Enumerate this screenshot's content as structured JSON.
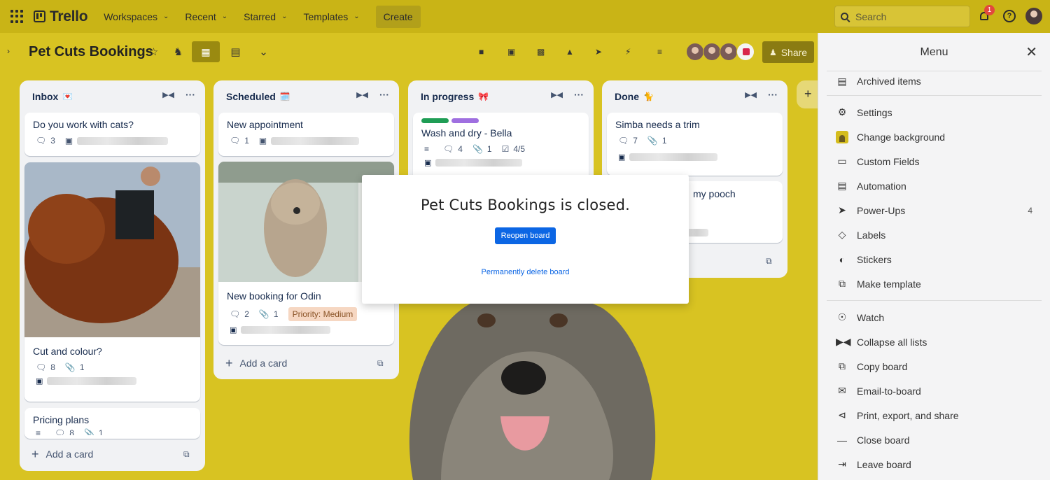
{
  "nav": {
    "logo": "Trello",
    "items": [
      "Workspaces",
      "Recent",
      "Starred",
      "Templates"
    ],
    "create": "Create",
    "search_placeholder": "Search",
    "notification_count": "1"
  },
  "board": {
    "title": "Pet Cuts Bookings",
    "share": "Share"
  },
  "lists": [
    {
      "title": "Inbox",
      "emoji": "💌",
      "cards": [
        {
          "title": "Do you work with cats?",
          "comments": "3"
        },
        {
          "title": "Cut and colour?",
          "comments": "8",
          "attachments": "1"
        },
        {
          "title": "Pricing plans",
          "comments": "8",
          "attachments": "1"
        }
      ],
      "add": "Add a card"
    },
    {
      "title": "Scheduled",
      "emoji": "🗓️",
      "cards": [
        {
          "title": "New appointment",
          "comments": "1"
        },
        {
          "title": "New booking for Odin",
          "comments": "2",
          "attachments": "1",
          "priority": "Priority: Medium"
        }
      ],
      "add": "Add a card"
    },
    {
      "title": "In progress",
      "emoji": "🎀",
      "cards": [
        {
          "title": "Wash and dry - Bella",
          "comments": "4",
          "attachments": "1",
          "checklist": "4/5",
          "labels": [
            "#1f9d55",
            "#9f6fe0"
          ]
        }
      ]
    },
    {
      "title": "Done",
      "emoji": "🐈",
      "cards": [
        {
          "title": "Simba needs a trim",
          "comments": "7",
          "attachments": "1"
        },
        {
          "title": "my pooch"
        }
      ]
    }
  ],
  "modal": {
    "message": "Pet Cuts Bookings is closed.",
    "reopen": "Reopen board",
    "delete": "Permanently delete board"
  },
  "menu": {
    "title": "Menu",
    "items": [
      {
        "label": "Archived items",
        "icon": "archive-icon"
      },
      {
        "label": "Settings",
        "icon": "gear-icon"
      },
      {
        "label": "Change background",
        "icon": "background-thumb"
      },
      {
        "label": "Custom Fields",
        "icon": "custom-fields-icon"
      },
      {
        "label": "Automation",
        "icon": "automation-icon"
      },
      {
        "label": "Power-Ups",
        "icon": "rocket-icon",
        "count": "4"
      },
      {
        "label": "Labels",
        "icon": "label-icon"
      },
      {
        "label": "Stickers",
        "icon": "sticker-icon"
      },
      {
        "label": "Make template",
        "icon": "template-icon"
      },
      {
        "label": "Watch",
        "icon": "eye-icon"
      },
      {
        "label": "Collapse all lists",
        "icon": "collapse-icon"
      },
      {
        "label": "Copy board",
        "icon": "copy-icon"
      },
      {
        "label": "Email-to-board",
        "icon": "email-icon"
      },
      {
        "label": "Print, export, and share",
        "icon": "share-icon"
      },
      {
        "label": "Close board",
        "icon": "minus-icon"
      },
      {
        "label": "Leave board",
        "icon": "leave-icon"
      }
    ]
  },
  "colors": {
    "board_bg": "#d8c322",
    "primary": "#0c66e4",
    "priority_bg": "#f6d7c2"
  }
}
